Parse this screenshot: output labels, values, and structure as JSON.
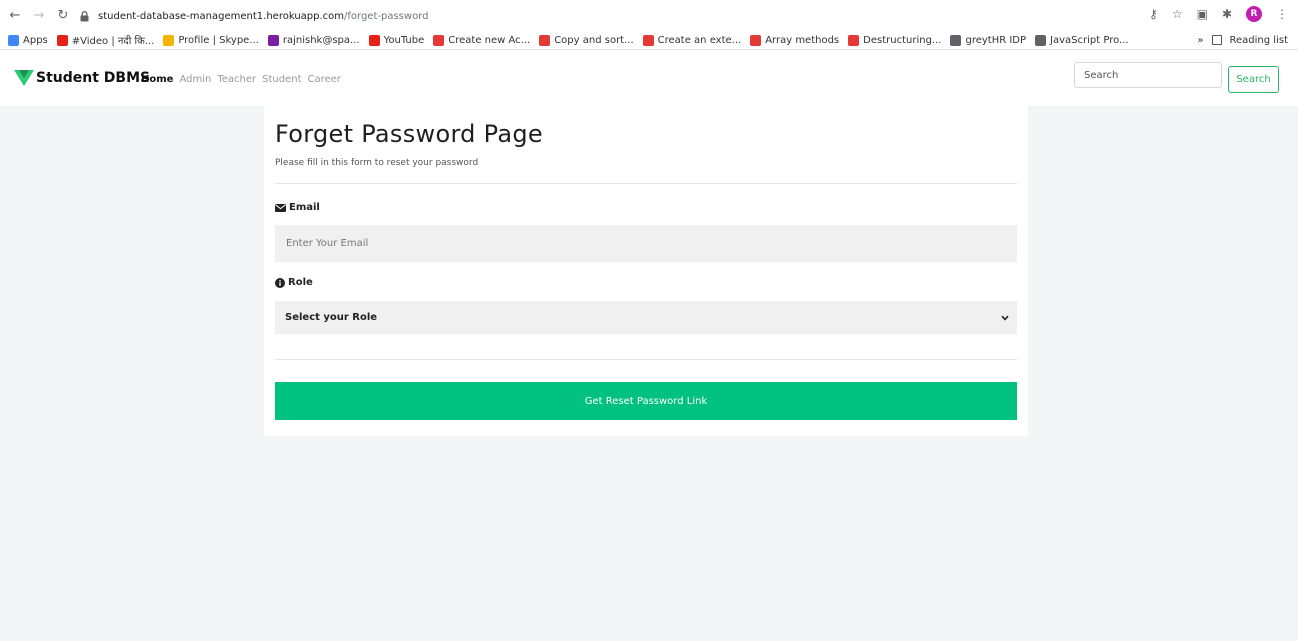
{
  "browser": {
    "url_host": "student-database-management1.herokuapp.com",
    "url_path": "/forget-password",
    "avatar_letter": "R",
    "bookmarks": [
      {
        "label": "Apps",
        "color": "#4285f4"
      },
      {
        "label": "#Video | नदी कि...",
        "color": "#e62117"
      },
      {
        "label": "Profile | Skype...",
        "color": "#f4b400"
      },
      {
        "label": "rajnishk@spa...",
        "color": "#7b1fa2"
      },
      {
        "label": "YouTube",
        "color": "#e62117"
      },
      {
        "label": "Create new Ac...",
        "color": "#e53935"
      },
      {
        "label": "Copy and sort...",
        "color": "#e53935"
      },
      {
        "label": "Create an exte...",
        "color": "#e53935"
      },
      {
        "label": "Array methods",
        "color": "#e53935"
      },
      {
        "label": "Destructuring...",
        "color": "#e53935"
      },
      {
        "label": "greytHR IDP",
        "color": "#5f6368"
      },
      {
        "label": "JavaScript Pro...",
        "color": "#5f6368"
      }
    ],
    "more_label": "»",
    "reading_list": "Reading list"
  },
  "navbar": {
    "brand": "Student DBMS",
    "brand_color": "#2ecc71",
    "links": [
      {
        "label": "Home",
        "active": true
      },
      {
        "label": "Admin",
        "active": false
      },
      {
        "label": "Teacher",
        "active": false
      },
      {
        "label": "Student",
        "active": false
      },
      {
        "label": "Career",
        "active": false
      }
    ],
    "search_placeholder": "Search",
    "search_button": "Search"
  },
  "form": {
    "title": "Forget Password Page",
    "subtitle": "Please fill in this form to reset your password",
    "email_label": "Email",
    "email_placeholder": "Enter Your Email",
    "role_label": "Role",
    "role_selected": "Select your Role",
    "submit_label": "Get Reset Password Link",
    "accent": "#00c17f"
  }
}
